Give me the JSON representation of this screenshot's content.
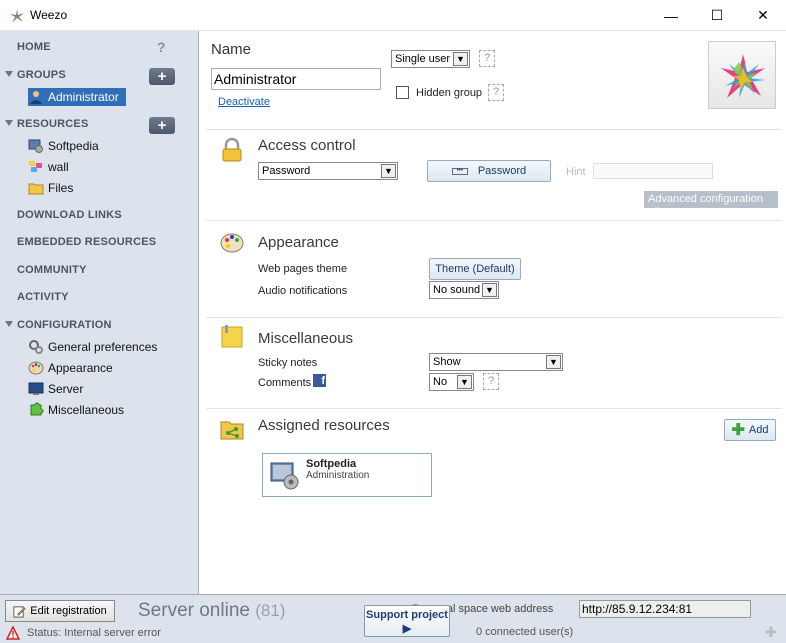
{
  "window": {
    "title": "Weezo",
    "minimize": "—",
    "maximize": "☐",
    "close": "✕"
  },
  "sidebar": {
    "home": "HOME",
    "help": "?",
    "groups": "GROUPS",
    "group_items": [
      {
        "label": "Administrator",
        "icon": "user-icon"
      }
    ],
    "resources": "RESOURCES",
    "resource_items": [
      {
        "label": "Softpedia",
        "icon": "server-icon"
      },
      {
        "label": "wall",
        "icon": "wall-icon"
      },
      {
        "label": "Files",
        "icon": "folder-icon"
      }
    ],
    "download_links": "DOWNLOAD LINKS",
    "embedded_resources": "EMBEDDED RESOURCES",
    "community": "COMMUNITY",
    "activity": "ACTIVITY",
    "configuration": "CONFIGURATION",
    "config_items": [
      {
        "label": "General preferences",
        "icon": "gears-icon"
      },
      {
        "label": "Appearance",
        "icon": "palette-icon"
      },
      {
        "label": "Server",
        "icon": "monitor-icon"
      },
      {
        "label": "Miscellaneous",
        "icon": "puzzle-icon"
      }
    ],
    "plus": "+"
  },
  "main": {
    "name_label": "Name",
    "name_value": "Administrator",
    "deactivate": "Deactivate",
    "user_mode": "Single user",
    "hidden_group": "Hidden group",
    "question": "?",
    "access": {
      "title": "Access control",
      "method": "Password",
      "password_button": "Password",
      "hint_label": "Hint",
      "advanced": "Advanced configuration"
    },
    "appearance": {
      "title": "Appearance",
      "theme_label": "Web pages theme",
      "theme_button": "Theme (Default)",
      "audio_label": "Audio notifications",
      "audio_value": "No sound"
    },
    "misc": {
      "title": "Miscellaneous",
      "sticky_label": "Sticky notes",
      "sticky_value": "Show",
      "comments_label": "Comments",
      "comments_value": "No"
    },
    "assigned": {
      "title": "Assigned resources",
      "add_button": "Add",
      "card_title": "Softpedia",
      "card_sub": "Administration"
    }
  },
  "status": {
    "edit_registration": "Edit registration",
    "server_online": "Server online",
    "server_count": "(81)",
    "status_text": "Status: Internal server error",
    "support": "Support project",
    "address_label": "Personal space web address",
    "address_value": "http://85.9.12.234:81",
    "connected": "0  connected user(s)"
  }
}
